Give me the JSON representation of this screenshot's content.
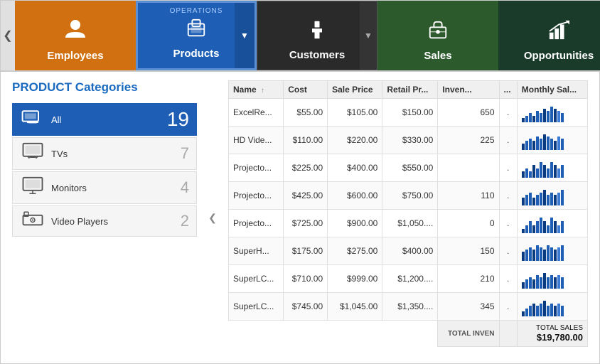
{
  "nav": {
    "prev_arrow": "❮",
    "next_arrow": "❯",
    "items": [
      {
        "id": "employees",
        "label": "Employees",
        "icon": "👤",
        "class": "employees"
      },
      {
        "id": "products",
        "label": "Products",
        "icon": "📦",
        "class": "products",
        "ops_label": "OPERATIONS",
        "has_dropdown": true
      },
      {
        "id": "customers",
        "label": "Customers",
        "icon": "👔",
        "class": "customers",
        "has_dropdown": true
      },
      {
        "id": "sales",
        "label": "Sales",
        "icon": "🛒",
        "class": "sales"
      },
      {
        "id": "opportunities",
        "label": "Opportunities",
        "icon": "📊",
        "class": "opportunities"
      }
    ]
  },
  "left": {
    "title_prefix": "PRODUCT",
    "title_suffix": " Categories",
    "categories": [
      {
        "id": "all",
        "label": "All",
        "icon": "🖥",
        "count": "19",
        "active": true
      },
      {
        "id": "tvs",
        "label": "TVs",
        "icon": "📺",
        "count": "7",
        "active": false
      },
      {
        "id": "monitors",
        "label": "Monitors",
        "icon": "🖥",
        "count": "4",
        "active": false
      },
      {
        "id": "video-players",
        "label": "Video Players",
        "icon": "📽",
        "count": "2",
        "active": false
      }
    ]
  },
  "table": {
    "columns": [
      "Name",
      "Cost",
      "Sale Price",
      "Retail Pr...",
      "Inven...",
      "...",
      "Monthly Sal..."
    ],
    "rows": [
      {
        "name": "ExcelRe...",
        "cost": "$55.00",
        "sale_price": "$105.00",
        "retail": "$150.00",
        "inventory": "650",
        "dot": ".",
        "monthly_chart": [
          2,
          3,
          4,
          3,
          5,
          4,
          6,
          5,
          7,
          6,
          5,
          4
        ]
      },
      {
        "name": "HD Vide...",
        "cost": "$110.00",
        "sale_price": "$220.00",
        "retail": "$330.00",
        "inventory": "225",
        "dot": ".",
        "monthly_chart": [
          3,
          4,
          5,
          4,
          6,
          5,
          7,
          6,
          5,
          4,
          6,
          5
        ]
      },
      {
        "name": "Projecto...",
        "cost": "$225.00",
        "sale_price": "$400.00",
        "retail": "$550.00",
        "inventory": "",
        "dot": ".",
        "monthly_chart": [
          2,
          3,
          2,
          4,
          3,
          5,
          4,
          3,
          5,
          4,
          3,
          4
        ]
      },
      {
        "name": "Projecto...",
        "cost": "$425.00",
        "sale_price": "$600.00",
        "retail": "$750.00",
        "inventory": "110",
        "dot": ".",
        "monthly_chart": [
          3,
          4,
          5,
          3,
          4,
          5,
          6,
          4,
          5,
          4,
          5,
          6
        ]
      },
      {
        "name": "Projecto...",
        "cost": "$725.00",
        "sale_price": "$900.00",
        "retail": "$1,050....",
        "inventory": "0",
        "dot": ".",
        "monthly_chart": [
          1,
          2,
          3,
          2,
          3,
          4,
          3,
          2,
          4,
          3,
          2,
          3
        ]
      },
      {
        "name": "SuperH...",
        "cost": "$175.00",
        "sale_price": "$275.00",
        "retail": "$400.00",
        "inventory": "150",
        "dot": ".",
        "monthly_chart": [
          4,
          5,
          6,
          5,
          7,
          6,
          5,
          7,
          6,
          5,
          6,
          7
        ]
      },
      {
        "name": "SuperLC...",
        "cost": "$710.00",
        "sale_price": "$999.00",
        "retail": "$1,200....",
        "inventory": "210",
        "dot": ".",
        "monthly_chart": [
          3,
          4,
          5,
          4,
          6,
          5,
          7,
          5,
          6,
          5,
          6,
          5
        ]
      },
      {
        "name": "SuperLC...",
        "cost": "$745.00",
        "sale_price": "$1,045.00",
        "retail": "$1,350....",
        "inventory": "345",
        "dot": ".",
        "monthly_chart": [
          2,
          3,
          4,
          5,
          4,
          5,
          6,
          4,
          5,
          4,
          5,
          4
        ]
      }
    ],
    "total_label_inven": "TOTAL INVEN",
    "total_label_sales": "TOTAL SALES",
    "total_sales_value": "$19,780.00"
  },
  "collapse_arrow": "❮"
}
